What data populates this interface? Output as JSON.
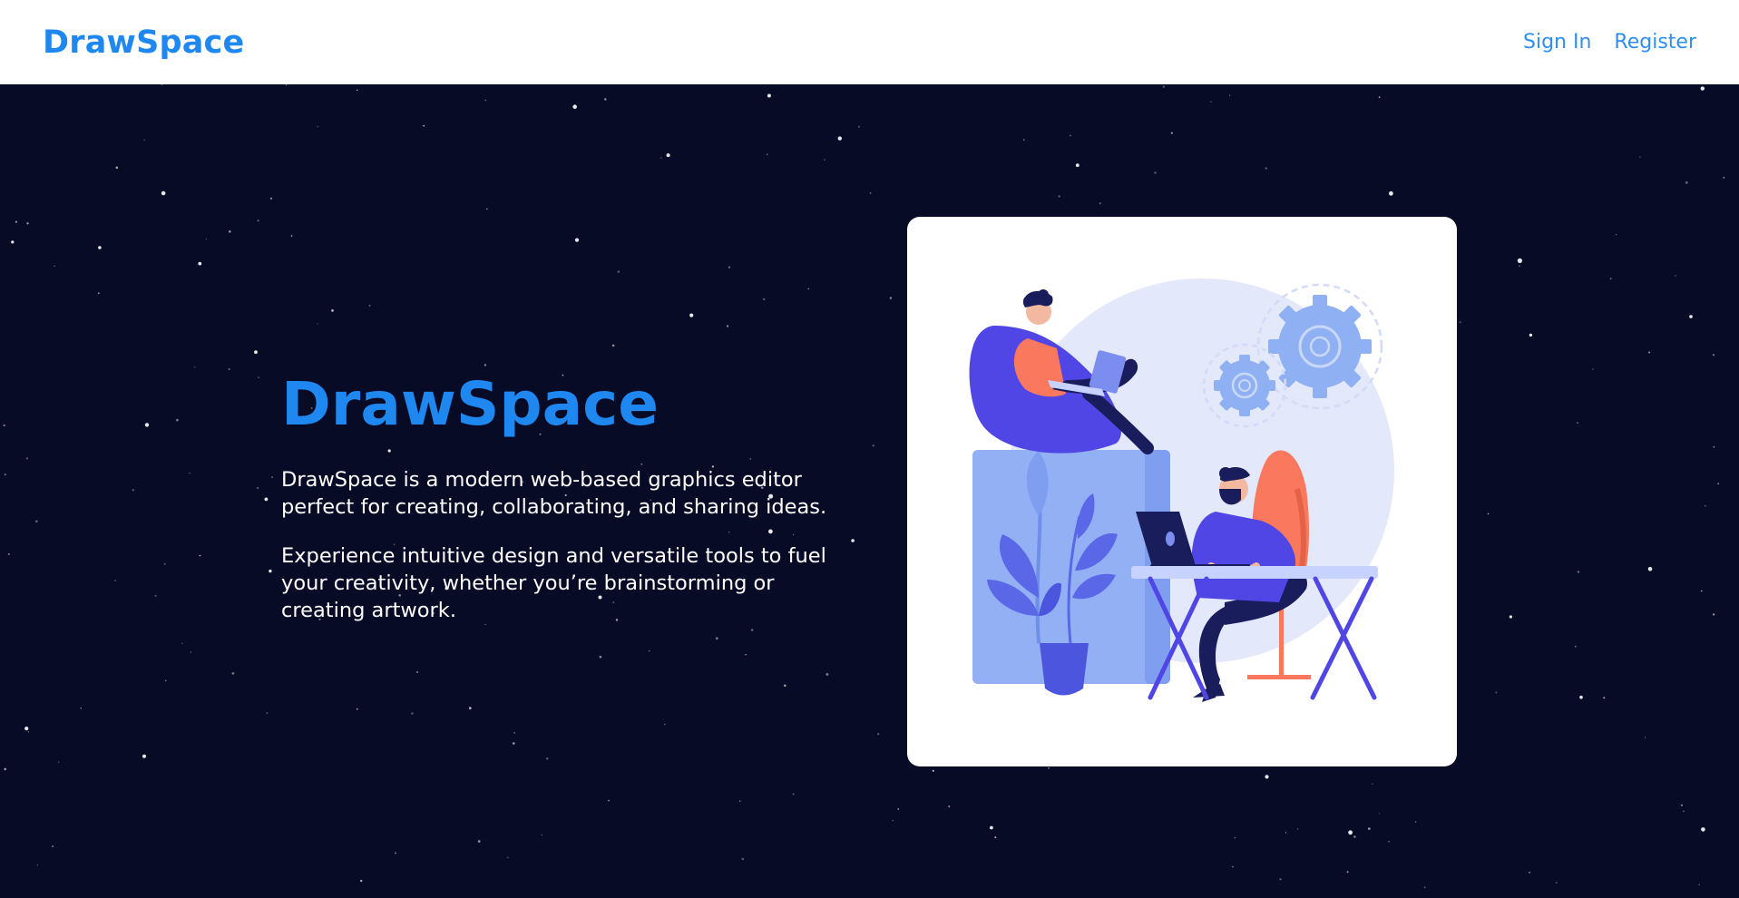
{
  "header": {
    "brand": "DrawSpace",
    "nav": [
      {
        "label": "Sign In"
      },
      {
        "label": "Register"
      }
    ]
  },
  "hero": {
    "title": "DrawSpace",
    "paragraphs": [
      "DrawSpace is a modern web-based graphics editor perfect for creating, collaborating, and sharing ideas.",
      "Experience intuitive design and versatile tools to fuel your creativity, whether you’re brainstorming or creating artwork."
    ],
    "illustration": "people-working-illustration"
  },
  "colors": {
    "accent": "#1e88f0",
    "background": "#070b26",
    "nav_link": "#2f8ff2"
  }
}
